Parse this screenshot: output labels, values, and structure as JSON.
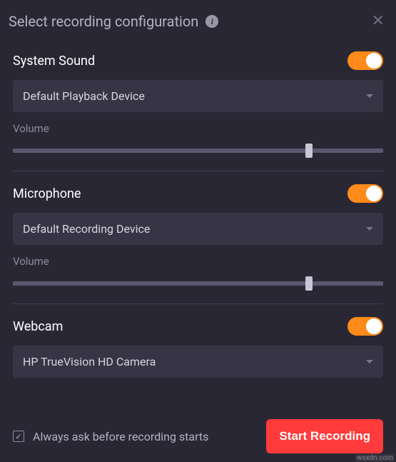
{
  "header": {
    "title": "Select recording configuration"
  },
  "systemSound": {
    "title": "System Sound",
    "device": "Default Playback Device",
    "volumeLabel": "Volume",
    "enabled": true,
    "volume": 80
  },
  "microphone": {
    "title": "Microphone",
    "device": "Default Recording Device",
    "volumeLabel": "Volume",
    "enabled": true,
    "volume": 80
  },
  "webcam": {
    "title": "Webcam",
    "device": "HP TrueVision HD Camera",
    "enabled": true
  },
  "footer": {
    "checkboxLabel": "Always ask before recording starts",
    "checked": true,
    "startButton": "Start Recording"
  },
  "watermark": "wsxdn.com"
}
